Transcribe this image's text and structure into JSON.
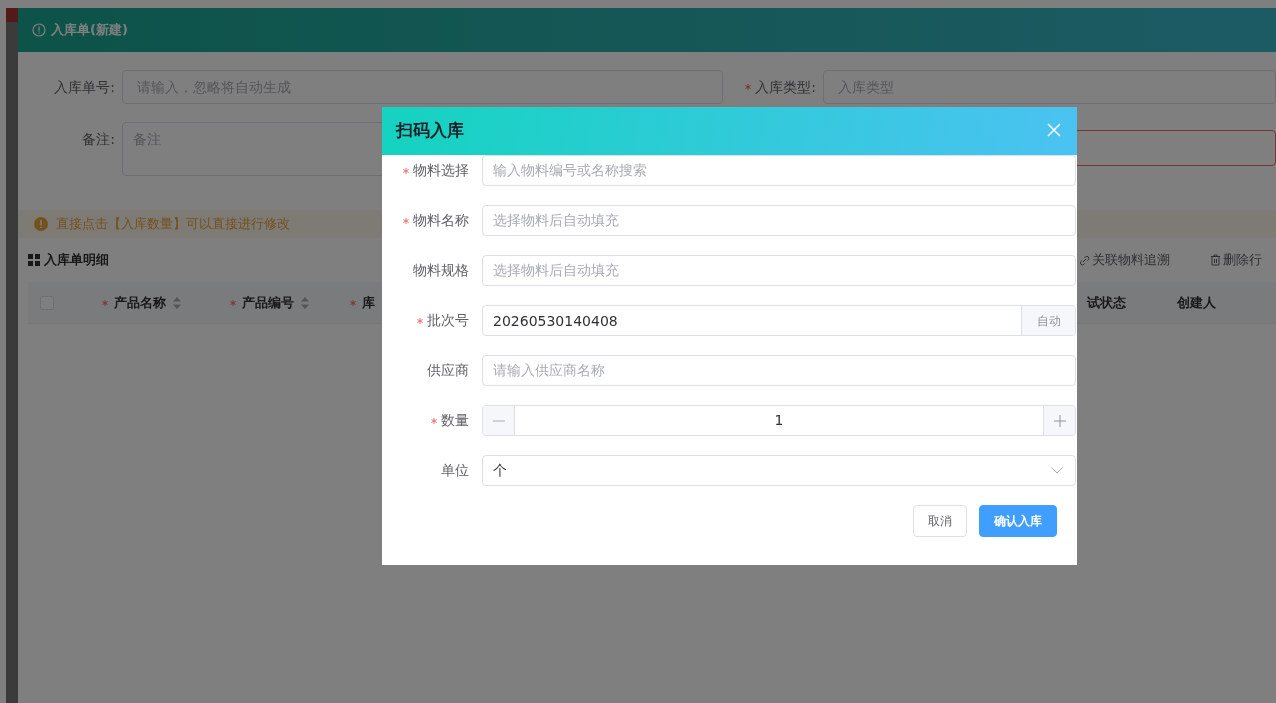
{
  "page": {
    "title": "入库单(新建)",
    "form": [
      {
        "kind": "input",
        "label": "入库单号:",
        "placeholder": "请输入，忽略将自动生成"
      },
      {
        "kind": "input",
        "label": "入库类型:",
        "required": true,
        "placeholder": "入库类型"
      },
      {
        "kind": "textarea",
        "label": "备注:",
        "placeholder": "备注"
      },
      {
        "kind": "input",
        "invalid": true
      }
    ],
    "alert": "直接点击【入库数量】可以直接进行修改",
    "section_title": "入库单明细",
    "actions": [
      {
        "kind": "link",
        "label": "关联物料追溯"
      },
      {
        "kind": "delete",
        "label": "删除行"
      }
    ],
    "table": {
      "select_all": {
        "checked": false
      },
      "columns": [
        {
          "label": "产品名称",
          "required": true,
          "sortable": true
        },
        {
          "label": "产品编号",
          "required": true,
          "sortable": true
        },
        {
          "label": "库",
          "required": true
        },
        {
          "label": "试状态"
        },
        {
          "label": "创建人"
        }
      ]
    }
  },
  "dialog": {
    "title": "扫码入库",
    "fields": [
      {
        "kind": "text",
        "label": "物料选择",
        "required": true,
        "placeholder": "输入物料编号或名称搜索"
      },
      {
        "kind": "text",
        "label": "物料名称",
        "required": true,
        "placeholder": "选择物料后自动填充"
      },
      {
        "kind": "text",
        "label": "物料规格",
        "placeholder": "选择物料后自动填充"
      },
      {
        "kind": "append",
        "label": "批次号",
        "required": true,
        "value": "20260530140408",
        "button": "自动"
      },
      {
        "kind": "text",
        "label": "供应商",
        "placeholder": "请输入供应商名称"
      },
      {
        "kind": "number",
        "label": "数量",
        "required": true,
        "value": "1"
      },
      {
        "kind": "select",
        "label": "单位",
        "value": "个"
      }
    ],
    "buttons": [
      {
        "kind": "default",
        "label": "取消"
      },
      {
        "kind": "primary",
        "label": "确认入库"
      }
    ]
  }
}
